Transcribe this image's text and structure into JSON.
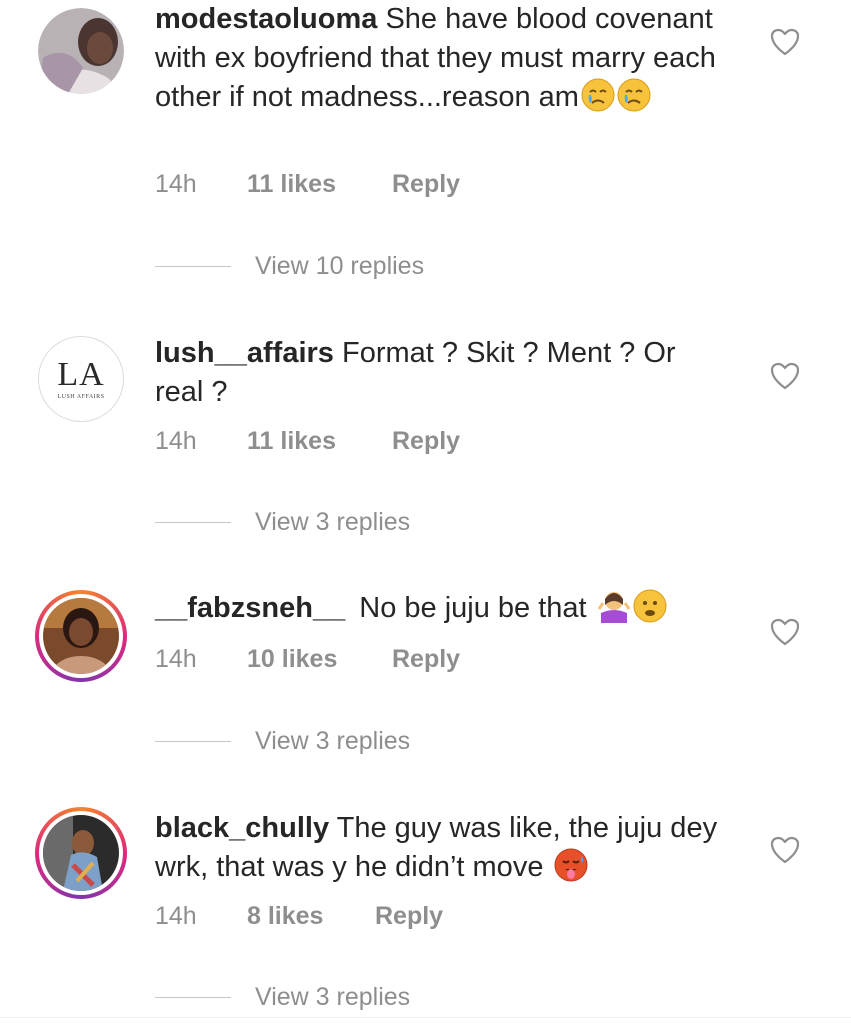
{
  "comments": [
    {
      "username": "modestaoluoma",
      "text": "She have blood covenant with ex boyfriend that they must marry each other if not madness...reason am",
      "emojis": [
        "crying-face",
        "crying-face"
      ],
      "time": "14h",
      "likes": "11 likes",
      "reply": "Reply",
      "view_replies": "View 10 replies"
    },
    {
      "username": "lush__affairs",
      "text": "Format ? Skit ? Ment ? Or real ?",
      "emojis": [],
      "time": "14h",
      "likes": "11 likes",
      "reply": "Reply",
      "view_replies": "View 3 replies",
      "avatar_logo": "LA",
      "avatar_logo_sub": "LUSH AFFAIRS"
    },
    {
      "username": "__fabzsneh__",
      "text": "No be juju be that",
      "emojis": [
        "woman-shrugging",
        "frowning-face"
      ],
      "time": "14h",
      "likes": "10 likes",
      "reply": "Reply",
      "view_replies": "View 3 replies"
    },
    {
      "username": "black_chully",
      "text": "The guy was like, the juju dey wrk, that was y he didn’t move",
      "emojis": [
        "hot-face"
      ],
      "time": "14h",
      "likes": "8 likes",
      "reply": "Reply",
      "view_replies": "View 3 replies"
    }
  ],
  "colors": {
    "text": "#262626",
    "secondary": "#8e8e8e",
    "story_ring_start": "#f58529",
    "story_ring_mid": "#dd2a7b",
    "story_ring_end": "#8134af"
  }
}
